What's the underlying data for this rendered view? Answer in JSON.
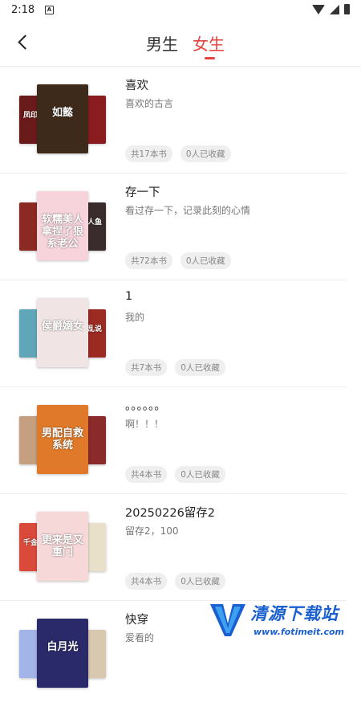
{
  "status_bar": {
    "time": "2:18",
    "notif_icon": "A"
  },
  "header": {
    "tab_male": "男生",
    "tab_female": "女生",
    "active_tab": "女生"
  },
  "lists": [
    {
      "title": "喜欢",
      "desc": "喜欢的古言",
      "count": "共17本书",
      "saved": "0人已收藏",
      "covers": {
        "left": "凤印",
        "main": "如懿",
        "right": ""
      },
      "colors": [
        "#6b1a1a",
        "#3d2a1a",
        "#8a1c20"
      ]
    },
    {
      "title": "存一下",
      "desc": "看过存一下，记录此刻的心情",
      "count": "共72本书",
      "saved": "0人已收藏",
      "covers": {
        "left": "",
        "main": "软糯美人拿捏了狠系老公",
        "right": "人鱼"
      },
      "colors": [
        "#8a2a22",
        "#f7d3dc",
        "#3a2c2c"
      ]
    },
    {
      "title": "1",
      "desc": "我的",
      "count": "共7本书",
      "saved": "0人已收藏",
      "covers": {
        "left": "",
        "main": "侯爵嫡女",
        "right": "乱说"
      },
      "colors": [
        "#5fa7b8",
        "#f0e4e4",
        "#9a2a22"
      ]
    },
    {
      "title": "。。。。。。",
      "desc": "啊！！！",
      "count": "共4本书",
      "saved": "0人已收藏",
      "covers": {
        "left": "",
        "main": "男配自救系统",
        "right": ""
      },
      "colors": [
        "#c4a080",
        "#e07a2a",
        "#8a2a2a"
      ]
    },
    {
      "title": "20250226留存2",
      "desc": "留存2，100",
      "count": "共4本书",
      "saved": "0人已收藏",
      "covers": {
        "left": "千金",
        "main": "更来是又重门",
        "right": ""
      },
      "colors": [
        "#d94a3a",
        "#f7d8d8",
        "#e8e0c8"
      ]
    },
    {
      "title": "快穿",
      "desc": "爱看的",
      "count": "",
      "saved": "",
      "covers": {
        "left": "",
        "main": "白月光",
        "right": ""
      },
      "colors": [
        "#a3b4e8",
        "#2a2a6a",
        "#d8c8b0"
      ]
    }
  ],
  "watermark": {
    "text": "清源下载站",
    "url": "www.fotimeit.com"
  }
}
